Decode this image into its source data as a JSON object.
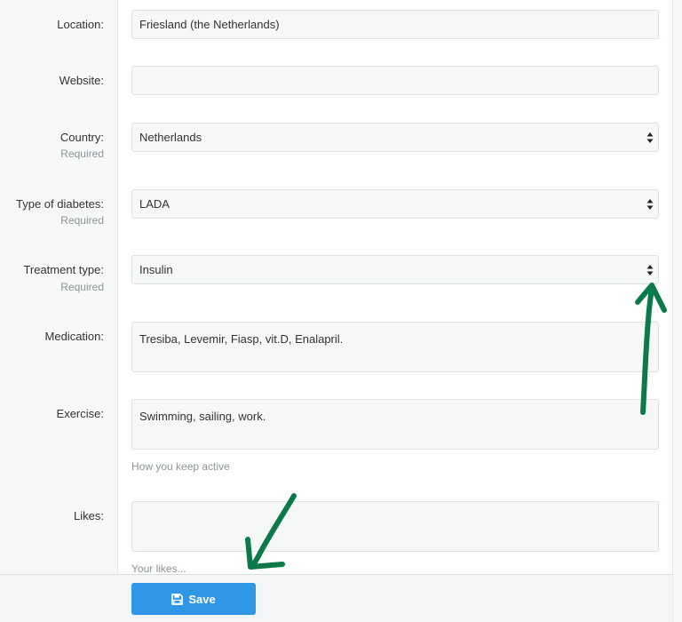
{
  "form": {
    "location": {
      "label": "Location:",
      "value": "Friesland (the Netherlands)"
    },
    "website": {
      "label": "Website:",
      "value": ""
    },
    "country": {
      "label": "Country:",
      "required": "Required",
      "value": "Netherlands"
    },
    "diabetes_type": {
      "label": "Type of diabetes:",
      "required": "Required",
      "value": "LADA"
    },
    "treatment": {
      "label": "Treatment type:",
      "required": "Required",
      "value": "Insulin"
    },
    "medication": {
      "label": "Medication:",
      "value": "Tresiba, Levemir, Fiasp, vit.D, Enalapril."
    },
    "exercise": {
      "label": "Exercise:",
      "value": "Swimming, sailing, work.",
      "help": "How you keep active"
    },
    "likes": {
      "label": "Likes:",
      "value": "",
      "help": "Your likes..."
    }
  },
  "footer": {
    "save_label": "Save"
  },
  "icons": {
    "save": "floppy-disk-icon",
    "select": "sort-arrows-icon"
  },
  "colors": {
    "primary": "#2f97e6",
    "annotation": "#0a7a4a"
  }
}
